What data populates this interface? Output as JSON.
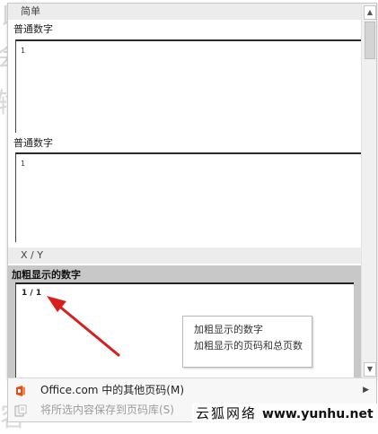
{
  "gallery": {
    "section_simple": "简单",
    "item_plain_top": {
      "label": "普通数字",
      "number": "1"
    },
    "item_plain_second": {
      "label": "普通数字",
      "number": "1"
    },
    "section_xy": "X / Y",
    "item_bold_selected": {
      "label": "加粗显示的数字",
      "number": "1 / 1"
    }
  },
  "tooltip": {
    "title": "加粗显示的数字",
    "description": "加粗显示的页码和总页数"
  },
  "menu": {
    "office_more": "Office.com 中的其他页码(M)",
    "save_selection": "将所选内容保存到页码库(S)"
  },
  "watermark": {
    "text": "云狐网络",
    "url": "www.yunhu.net"
  },
  "colors": {
    "selected_bg": "#c8c8c8",
    "arrow_red": "#d91e1e"
  }
}
